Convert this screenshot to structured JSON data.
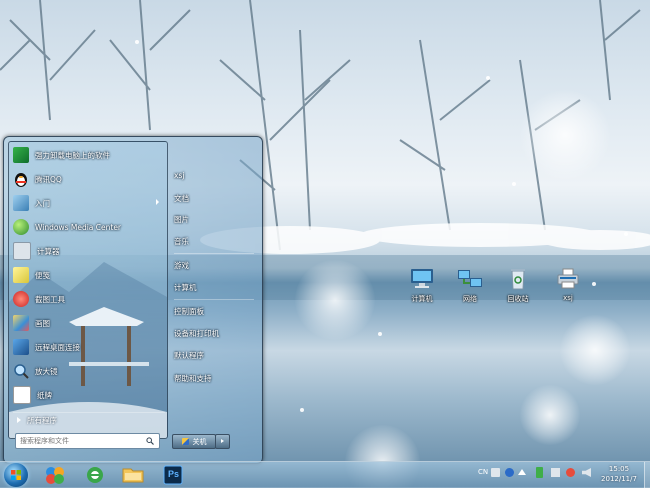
{
  "start_menu": {
    "programs": [
      {
        "label": "强力卸载电脑上的软件",
        "icon": "uninstall-icon"
      },
      {
        "label": "腾讯QQ",
        "icon": "qq-penguin-icon"
      },
      {
        "label": "入门",
        "icon": "getting-started-icon",
        "has_submenu": true
      },
      {
        "label": "Windows Media Center",
        "icon": "media-center-icon"
      },
      {
        "label": "计算器",
        "icon": "calculator-icon"
      },
      {
        "label": "便笺",
        "icon": "sticky-notes-icon"
      },
      {
        "label": "截图工具",
        "icon": "snipping-tool-icon"
      },
      {
        "label": "画图",
        "icon": "paint-icon"
      },
      {
        "label": "远程桌面连接",
        "icon": "remote-desktop-icon"
      },
      {
        "label": "放大镜",
        "icon": "magnifier-icon"
      },
      {
        "label": "纸牌",
        "icon": "solitaire-icon"
      }
    ],
    "all_programs": "所有程序",
    "search_placeholder": "搜索程序和文件",
    "right_items": [
      "xsj",
      "文档",
      "图片",
      "音乐",
      "游戏",
      "计算机",
      "控制面板",
      "设备和打印机",
      "默认程序",
      "帮助和支持"
    ],
    "shutdown_label": "关机"
  },
  "desktop_icons": [
    {
      "label": "计算机",
      "icon": "computer-icon"
    },
    {
      "label": "网络",
      "icon": "network-icon"
    },
    {
      "label": "回收站",
      "icon": "recycle-bin-icon"
    },
    {
      "label": "xsj",
      "icon": "printer-icon"
    }
  ],
  "taskbar": {
    "pinned": [
      "windows-live-icon",
      "internet-explorer-icon",
      "file-explorer-icon",
      "photoshop-icon"
    ],
    "photoshop_text": "Ps",
    "language": "CN",
    "time": "15:05",
    "date": "2012/11/7"
  }
}
